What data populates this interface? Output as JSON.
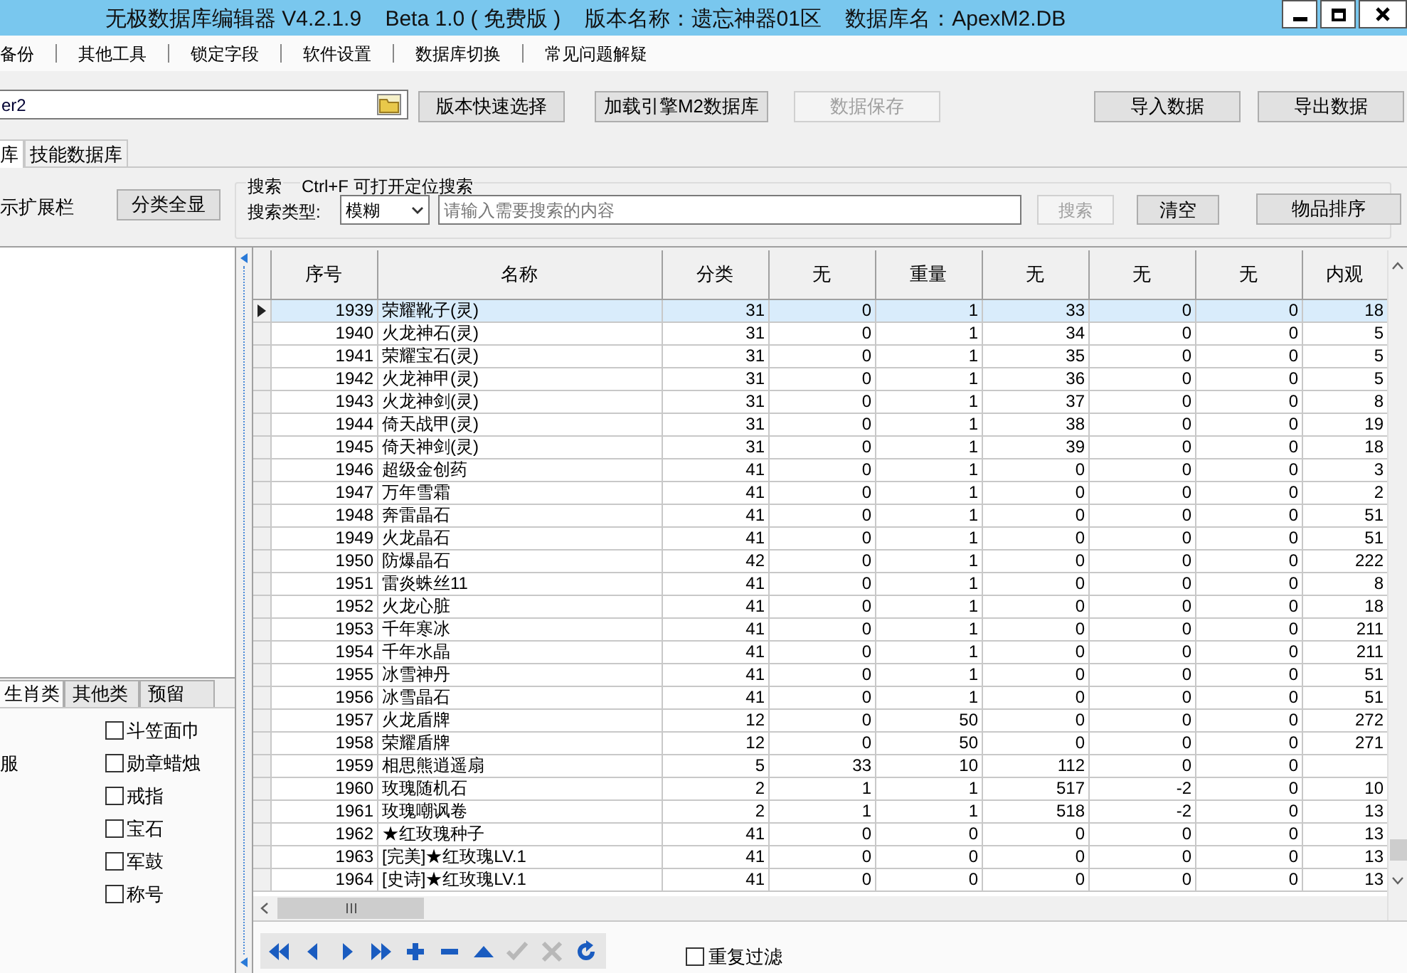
{
  "window": {
    "title": "无极数据库编辑器 V4.2.1.9    Beta 1.0 ( 免费版 )    版本名称：遗忘神器01区    数据库名：ApexM2.DB"
  },
  "menu": [
    "备份",
    "其他工具",
    "锁定字段",
    "软件设置",
    "数据库切换",
    "常见问题解疑"
  ],
  "toolbar": {
    "path_value": "er2",
    "buttons": [
      {
        "label": "版本快速选择",
        "disabled": false
      },
      {
        "label": "加载引擎M2数据库",
        "disabled": false
      },
      {
        "label": "数据保存",
        "disabled": true
      },
      {
        "label": "导入数据",
        "disabled": false
      },
      {
        "label": "导出数据",
        "disabled": false
      }
    ]
  },
  "tabs": [
    {
      "label": "库",
      "selected": true
    },
    {
      "label": "技能数据库",
      "selected": false
    }
  ],
  "side": {
    "toggle_label": "示扩展栏",
    "show_all_button": "分类全显",
    "category_tabs": [
      {
        "label": "生肖类",
        "selected": true
      },
      {
        "label": "其他类",
        "selected": false
      },
      {
        "label": "预留",
        "selected": false
      }
    ],
    "cut_label": "服",
    "right_items": [
      {
        "label": "斗笠面巾",
        "checked": false
      },
      {
        "label": "勋章蜡烛",
        "checked": false
      },
      {
        "label": "戒指",
        "checked": false
      },
      {
        "label": "宝石",
        "checked": false
      },
      {
        "label": "军鼓",
        "checked": false
      },
      {
        "label": "称号",
        "checked": false
      }
    ]
  },
  "search": {
    "title": "搜索",
    "hint": "Ctrl+F 可打开定位搜索",
    "type_label": "搜索类型:",
    "type_value": "模糊",
    "placeholder": "请输入需要搜索的内容",
    "search_button": {
      "label": "搜索",
      "disabled": true
    },
    "clear_button": "清空"
  },
  "sort_button": "物品排序",
  "table": {
    "columns": [
      "序号",
      "名称",
      "分类",
      "无",
      "重量",
      "无",
      "无",
      "无",
      "内观"
    ],
    "rows": [
      {
        "selected": true,
        "cells": [
          "1939",
          "荣耀靴子(灵)",
          "31",
          "0",
          "1",
          "33",
          "0",
          "0",
          "18"
        ]
      },
      {
        "selected": false,
        "cells": [
          "1940",
          "火龙神石(灵)",
          "31",
          "0",
          "1",
          "34",
          "0",
          "0",
          "5"
        ]
      },
      {
        "selected": false,
        "cells": [
          "1941",
          "荣耀宝石(灵)",
          "31",
          "0",
          "1",
          "35",
          "0",
          "0",
          "5"
        ]
      },
      {
        "selected": false,
        "cells": [
          "1942",
          "火龙神甲(灵)",
          "31",
          "0",
          "1",
          "36",
          "0",
          "0",
          "5"
        ]
      },
      {
        "selected": false,
        "cells": [
          "1943",
          "火龙神剑(灵)",
          "31",
          "0",
          "1",
          "37",
          "0",
          "0",
          "8"
        ]
      },
      {
        "selected": false,
        "cells": [
          "1944",
          "倚天战甲(灵)",
          "31",
          "0",
          "1",
          "38",
          "0",
          "0",
          "19"
        ]
      },
      {
        "selected": false,
        "cells": [
          "1945",
          "倚天神剑(灵)",
          "31",
          "0",
          "1",
          "39",
          "0",
          "0",
          "18"
        ]
      },
      {
        "selected": false,
        "cells": [
          "1946",
          "超级金创药",
          "41",
          "0",
          "1",
          "0",
          "0",
          "0",
          "3"
        ]
      },
      {
        "selected": false,
        "cells": [
          "1947",
          "万年雪霜",
          "41",
          "0",
          "1",
          "0",
          "0",
          "0",
          "2"
        ]
      },
      {
        "selected": false,
        "cells": [
          "1948",
          "奔雷晶石",
          "41",
          "0",
          "1",
          "0",
          "0",
          "0",
          "51"
        ]
      },
      {
        "selected": false,
        "cells": [
          "1949",
          "火龙晶石",
          "41",
          "0",
          "1",
          "0",
          "0",
          "0",
          "51"
        ]
      },
      {
        "selected": false,
        "cells": [
          "1950",
          "防爆晶石",
          "42",
          "0",
          "1",
          "0",
          "0",
          "0",
          "222"
        ]
      },
      {
        "selected": false,
        "cells": [
          "1951",
          "雷炎蛛丝11",
          "41",
          "0",
          "1",
          "0",
          "0",
          "0",
          "8"
        ]
      },
      {
        "selected": false,
        "cells": [
          "1952",
          "火龙心脏",
          "41",
          "0",
          "1",
          "0",
          "0",
          "0",
          "18"
        ]
      },
      {
        "selected": false,
        "cells": [
          "1953",
          "千年寒冰",
          "41",
          "0",
          "1",
          "0",
          "0",
          "0",
          "211"
        ]
      },
      {
        "selected": false,
        "cells": [
          "1954",
          "千年水晶",
          "41",
          "0",
          "1",
          "0",
          "0",
          "0",
          "211"
        ]
      },
      {
        "selected": false,
        "cells": [
          "1955",
          "冰雪神丹",
          "41",
          "0",
          "1",
          "0",
          "0",
          "0",
          "51"
        ]
      },
      {
        "selected": false,
        "cells": [
          "1956",
          "冰雪晶石",
          "41",
          "0",
          "1",
          "0",
          "0",
          "0",
          "51"
        ]
      },
      {
        "selected": false,
        "cells": [
          "1957",
          "火龙盾牌",
          "12",
          "0",
          "50",
          "0",
          "0",
          "0",
          "272"
        ]
      },
      {
        "selected": false,
        "cells": [
          "1958",
          "荣耀盾牌",
          "12",
          "0",
          "50",
          "0",
          "0",
          "0",
          "271"
        ]
      },
      {
        "selected": false,
        "cells": [
          "1959",
          "相思熊逍遥扇",
          "5",
          "33",
          "10",
          "112",
          "0",
          "0",
          null
        ]
      },
      {
        "selected": false,
        "cells": [
          "1960",
          "玫瑰随机石",
          "2",
          "1",
          "1",
          "517",
          "-2",
          "0",
          "10"
        ]
      },
      {
        "selected": false,
        "cells": [
          "1961",
          "玫瑰嘲讽卷",
          "2",
          "1",
          "1",
          "518",
          "-2",
          "0",
          "13"
        ]
      },
      {
        "selected": false,
        "cells": [
          "1962",
          "★红玫瑰种子",
          "41",
          "0",
          "0",
          "0",
          "0",
          "0",
          "13"
        ]
      },
      {
        "selected": false,
        "cells": [
          "1963",
          "[完美]★红玫瑰LV.1",
          "41",
          "0",
          "0",
          "0",
          "0",
          "0",
          "13"
        ]
      },
      {
        "selected": false,
        "cells": [
          "1964",
          "[史诗]★红玫瑰LV.1",
          "41",
          "0",
          "0",
          "0",
          "0",
          "0",
          "13"
        ]
      }
    ]
  },
  "navigator": [
    {
      "kind": "first",
      "disabled": false
    },
    {
      "kind": "prior",
      "disabled": false
    },
    {
      "kind": "next",
      "disabled": false
    },
    {
      "kind": "last",
      "disabled": false
    },
    {
      "kind": "insert",
      "disabled": false
    },
    {
      "kind": "delete",
      "disabled": false
    },
    {
      "kind": "edit",
      "disabled": false
    },
    {
      "kind": "post",
      "disabled": true
    },
    {
      "kind": "cancel",
      "disabled": true
    },
    {
      "kind": "refresh",
      "disabled": false
    }
  ],
  "dedupe_filter": {
    "label": "重复过滤",
    "checked": false
  }
}
